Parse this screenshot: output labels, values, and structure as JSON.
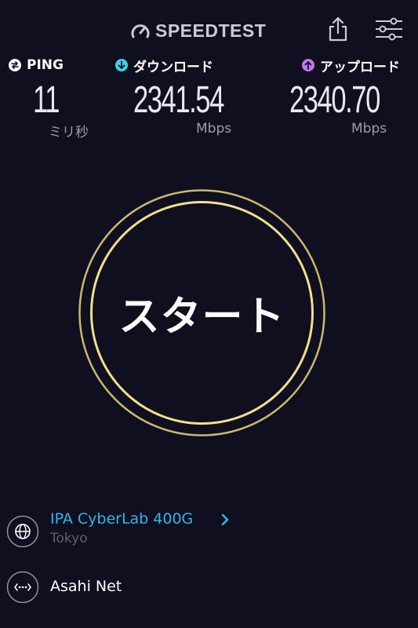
{
  "header": {
    "logo_text": "SPEEDTEST",
    "icons": [
      "speedtest-logo-icon",
      "share-icon",
      "settings-sliders-icon"
    ]
  },
  "metrics": {
    "ping": {
      "label": "PING",
      "value": "11",
      "unit": "ミリ秒",
      "icon": "ping-icon",
      "color": "#ffffff"
    },
    "download": {
      "label": "ダウンロード",
      "value": "2341.54",
      "unit": "Mbps",
      "icon": "download-arrow-icon",
      "color": "#3fd3e3"
    },
    "upload": {
      "label": "アップロード",
      "value": "2340.70",
      "unit": "Mbps",
      "icon": "upload-arrow-icon",
      "color": "#c077f0"
    }
  },
  "start_button": {
    "label": "スタート",
    "ring_color": "#e9d98a"
  },
  "server": {
    "name": "IPA CyberLab 400G",
    "location": "Tokyo",
    "name_color": "#32b6e6",
    "icon": "globe-icon"
  },
  "isp": {
    "name": "Asahi Net",
    "icon": "connection-dots-icon"
  }
}
